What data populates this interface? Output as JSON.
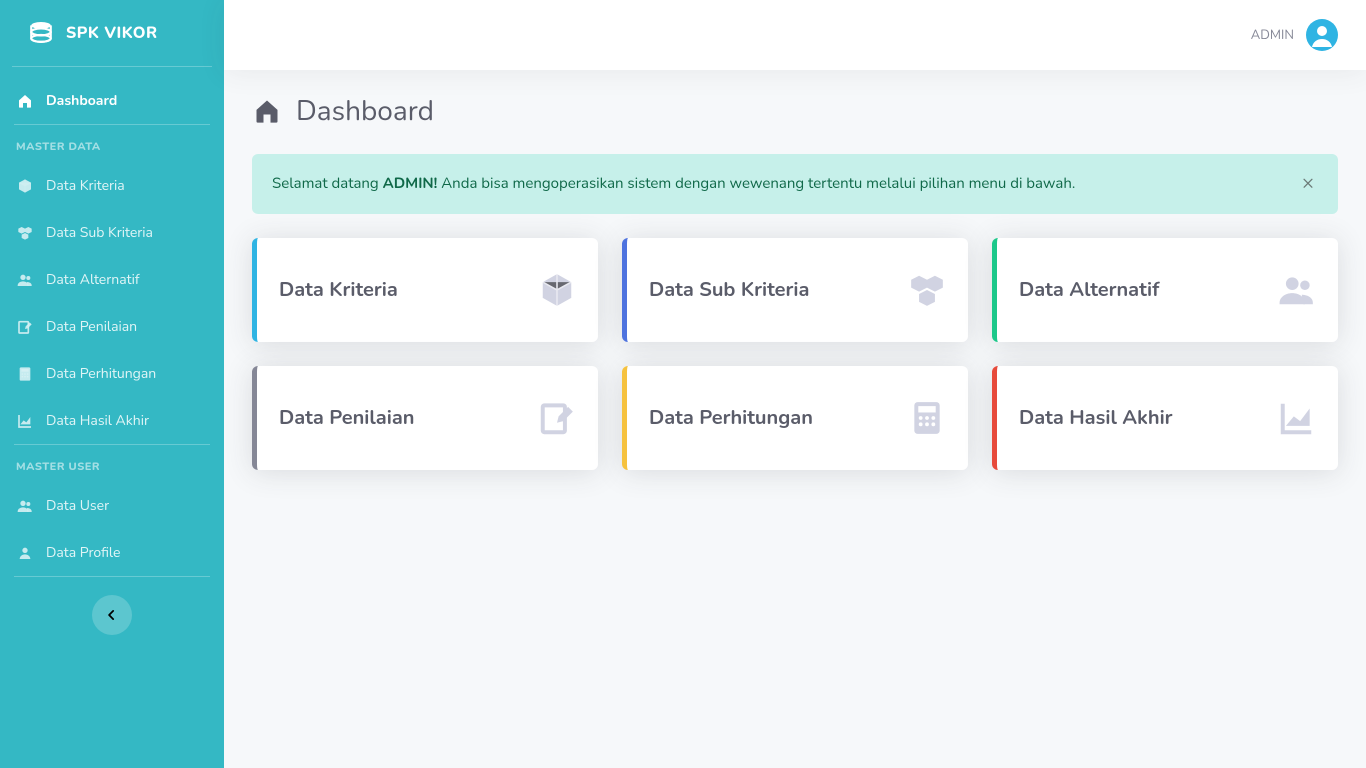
{
  "brand": "SPK VIKOR",
  "topbar": {
    "user": "ADMIN"
  },
  "page": {
    "title": "Dashboard"
  },
  "alert": {
    "prefix": "Selamat datang ",
    "strong": "ADMIN!",
    "rest": " Anda bisa mengoperasikan sistem dengan wewenang tertentu melalui pilihan menu di bawah."
  },
  "sidebar": {
    "dashboard": "Dashboard",
    "heading_master_data": "MASTER DATA",
    "items_data": [
      "Data Kriteria",
      "Data Sub Kriteria",
      "Data Alternatif",
      "Data Penilaian",
      "Data Perhitungan",
      "Data Hasil Akhir"
    ],
    "heading_master_user": "MASTER USER",
    "items_user": [
      "Data User",
      "Data Profile"
    ]
  },
  "cards": [
    {
      "title": "Data Kriteria",
      "accent": "primary",
      "icon": "cube"
    },
    {
      "title": "Data Sub Kriteria",
      "accent": "blue",
      "icon": "cubes"
    },
    {
      "title": "Data Alternatif",
      "accent": "green",
      "icon": "users"
    },
    {
      "title": "Data Penilaian",
      "accent": "gray",
      "icon": "edit"
    },
    {
      "title": "Data Perhitungan",
      "accent": "yellow",
      "icon": "calculator"
    },
    {
      "title": "Data Hasil Akhir",
      "accent": "red",
      "icon": "chart"
    }
  ]
}
